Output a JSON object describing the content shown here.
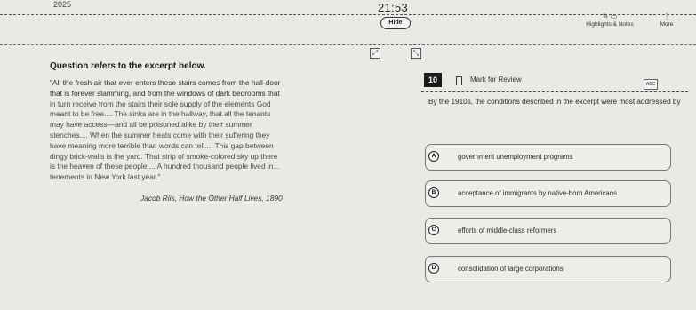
{
  "header": {
    "year_fragment": "2025",
    "timer": "21:53",
    "hide_label": "Hide",
    "highlights_label": "Highlights & Notes",
    "more_label": "More",
    "more_icon": "more-vertical-icon",
    "highlight_icon": "highlighter-icon",
    "notes_icon": "notes-icon"
  },
  "passage": {
    "question_heading": "Question refers to the excerpt below.",
    "excerpt_lines": [
      "\"All the fresh air that ever enters these stairs comes from the hall-door",
      "that is forever slamming, and from the windows of dark bedrooms that",
      "in turn receive from the stairs their sole supply of the elements God",
      "meant to be free.... The sinks are in the hallway, that all the tenants",
      "may have access—and all be poisoned alike by their summer",
      "stenches.... When the summer heats come with their suffering they",
      "have meaning more terrible than words can tell.... This gap between",
      "dingy brick-walls is the yard. That strip of smoke-colored sky up there",
      "is the heaven of these people.... A hundred thousand people lived in...",
      "tenements in New York last year.\""
    ],
    "citation": "Jacob Riis, How the Other Half Lives, 1890"
  },
  "question": {
    "number": "10",
    "mark_for_review": "Mark for Review",
    "abc_label": "ABC",
    "stem": "By the 1910s, the conditions described in the excerpt were most addressed by",
    "choices": [
      {
        "letter": "A",
        "text": "government unemployment programs"
      },
      {
        "letter": "B",
        "text": "acceptance of immigrants by native-born Americans"
      },
      {
        "letter": "C",
        "text": "efforts of middle-class reformers"
      },
      {
        "letter": "D",
        "text": "consolidation of large corporations"
      }
    ]
  }
}
